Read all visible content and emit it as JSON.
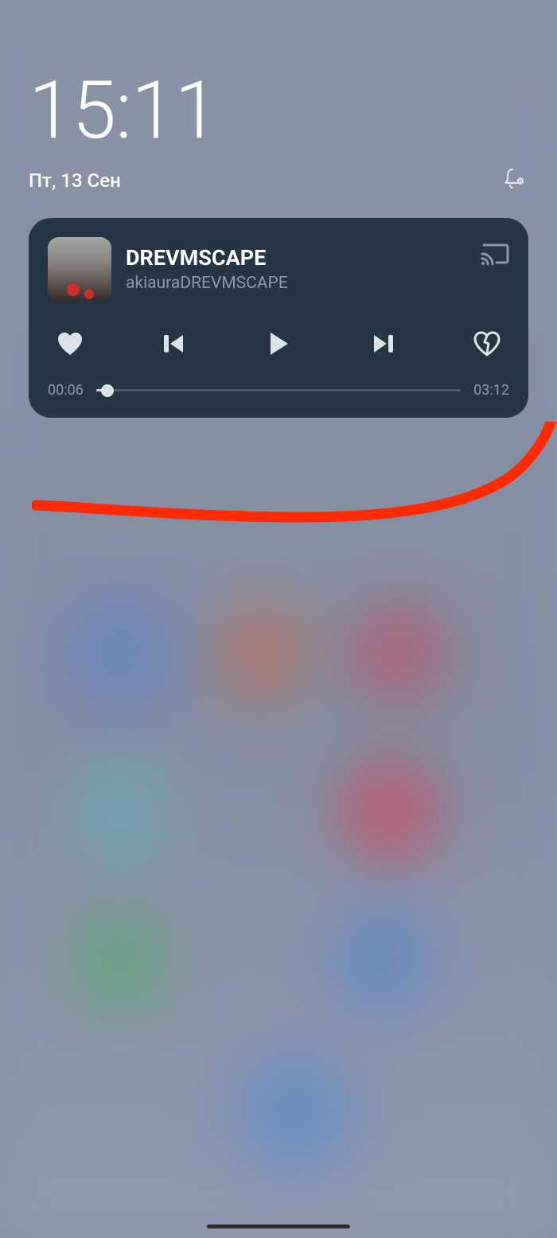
{
  "lockscreen": {
    "time": "15:11",
    "date": "Пт, 13 Сен"
  },
  "media": {
    "title": "DREVMSCAPE",
    "artist": "akiauraDREVMSCAPE",
    "elapsed": "00:06",
    "duration": "03:12",
    "progress_percent": 3
  }
}
